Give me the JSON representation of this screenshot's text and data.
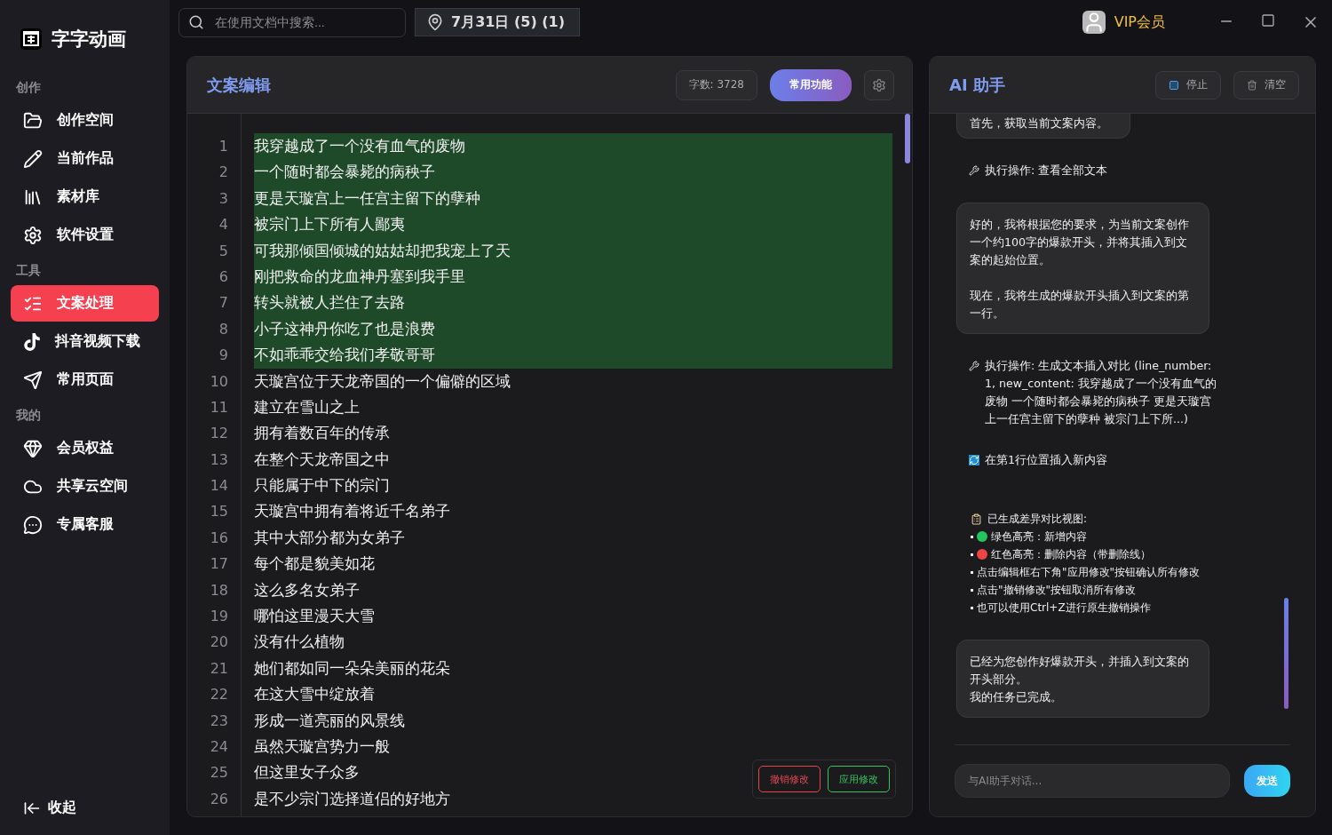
{
  "app": {
    "name": "字字动画"
  },
  "sidebar": {
    "groups": [
      {
        "label": "创作",
        "items": [
          {
            "label": "创作空间",
            "selected": false
          },
          {
            "label": "当前作品",
            "selected": false
          },
          {
            "label": "素材库",
            "selected": false
          },
          {
            "label": "软件设置",
            "selected": false
          }
        ]
      },
      {
        "label": "工具",
        "items": [
          {
            "label": "文案处理",
            "selected": true
          },
          {
            "label": "抖音视频下载",
            "selected": false
          },
          {
            "label": "常用页面",
            "selected": false
          }
        ]
      },
      {
        "label": "我的",
        "items": [
          {
            "label": "会员权益",
            "selected": false
          },
          {
            "label": "共享云空间",
            "selected": false
          },
          {
            "label": "专属客服",
            "selected": false
          }
        ]
      }
    ],
    "collapse": "收起"
  },
  "topbar": {
    "search": {
      "placeholder": "在使用文档中搜索..."
    },
    "doc": "7月31日 (5) (1)",
    "vip": "VIP会员"
  },
  "editor": {
    "title": "文案编辑",
    "word_count": "字数: 3728",
    "common_button": "常用功能",
    "lines": [
      {
        "number": "1",
        "text": "我穿越成了一个没有血气的废物",
        "added": true
      },
      {
        "number": "2",
        "text": "一个随时都会暴毙的病秧子",
        "added": true
      },
      {
        "number": "3",
        "text": "更是天璇宫上一任宫主留下的孽种",
        "added": true
      },
      {
        "number": "4",
        "text": "被宗门上下所有人鄙夷",
        "added": true
      },
      {
        "number": "5",
        "text": "可我那倾国倾城的姑姑却把我宠上了天",
        "added": true
      },
      {
        "number": "6",
        "text": "刚把救命的龙血神丹塞到我手里",
        "added": true
      },
      {
        "number": "7",
        "text": "转头就被人拦住了去路",
        "added": true
      },
      {
        "number": "8",
        "text": "小子这神丹你吃了也是浪费",
        "added": true
      },
      {
        "number": "9",
        "text": "不如乖乖交给我们孝敬哥哥",
        "added": true
      },
      {
        "number": "10",
        "text": "天璇宫位于天龙帝国的一个偏僻的区域",
        "added": false
      },
      {
        "number": "11",
        "text": "建立在雪山之上",
        "added": false
      },
      {
        "number": "12",
        "text": "拥有着数百年的传承",
        "added": false
      },
      {
        "number": "13",
        "text": "在整个天龙帝国之中",
        "added": false
      },
      {
        "number": "14",
        "text": "只能属于中下的宗门",
        "added": false
      },
      {
        "number": "15",
        "text": "天璇宫中拥有着将近千名弟子",
        "added": false
      },
      {
        "number": "16",
        "text": "其中大部分都为女弟子",
        "added": false
      },
      {
        "number": "17",
        "text": "每个都是貌美如花",
        "added": false
      },
      {
        "number": "18",
        "text": "这么多名女弟子",
        "added": false
      },
      {
        "number": "19",
        "text": "哪怕这里漫天大雪",
        "added": false
      },
      {
        "number": "20",
        "text": "没有什么植物",
        "added": false
      },
      {
        "number": "21",
        "text": "她们都如同一朵朵美丽的花朵",
        "added": false
      },
      {
        "number": "22",
        "text": "在这大雪中绽放着",
        "added": false
      },
      {
        "number": "23",
        "text": "形成一道亮丽的风景线",
        "added": false
      },
      {
        "number": "24",
        "text": "虽然天璇宫势力一般",
        "added": false
      },
      {
        "number": "25",
        "text": "但这里女子众多",
        "added": false
      },
      {
        "number": "26",
        "text": "是不少宗门选择道侣的好地方",
        "added": false
      }
    ],
    "revert_button": "撤销修改",
    "apply_button": "应用修改"
  },
  "assistant": {
    "title": "AI 助手",
    "stop_button": "停止",
    "clear_button": "清空",
    "messages": [
      {
        "kind": "bubble",
        "paragraphs": [
          [
            "首先，获取当前文案内容。"
          ]
        ]
      },
      {
        "kind": "action",
        "text": "执行操作: 查看全部文本"
      },
      {
        "kind": "bubble",
        "paragraphs": [
          [
            "好的，我将根据您的要求，为当前文案创作一个约100字的爆款开头，并将其插入到文案的起始位置。"
          ],
          [
            "现在，我将生成的爆款开头插入到文案的第一行。"
          ]
        ]
      },
      {
        "kind": "action",
        "text": "执行操作: 生成文本插入对比 (line_number: 1, new_content: 我穿越成了一个没有血气的废物 一个随时都会暴毙的病秧子 更是天璇宫上一任宫主留下的孽种 被宗门上下所...)"
      },
      {
        "kind": "info",
        "text": "在第1行位置插入新内容"
      },
      {
        "kind": "diff",
        "title": "已生成差异对比视图:",
        "items": [
          {
            "text": "绿色高亮：新增内容",
            "color": "#22c55e"
          },
          {
            "text": "红色高亮：删除内容（带删除线）",
            "color": "#ef4444"
          },
          {
            "text": "点击编辑框右下角\"应用修改\"按钮确认所有修改"
          },
          {
            "text": "点击\"撤销修改\"按钮取消所有修改"
          },
          {
            "text": "也可以使用Ctrl+Z进行原生撤销操作"
          }
        ]
      },
      {
        "kind": "bubble",
        "paragraphs": [
          [
            "已经为您创作好爆款开头，并插入到文案的开头部分。",
            "我的任务已完成。"
          ]
        ]
      }
    ],
    "input": {
      "placeholder": "与AI助手对话..."
    },
    "send_button": "发送"
  }
}
